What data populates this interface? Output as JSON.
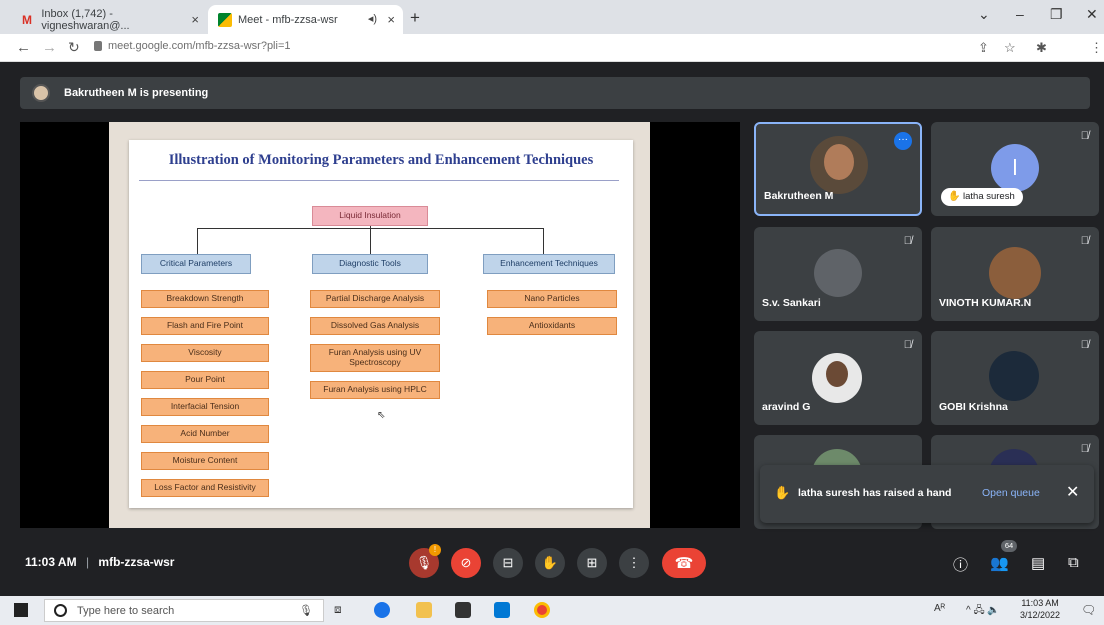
{
  "browser": {
    "tabs": [
      {
        "label": "Inbox (1,742) - vigneshwaran@...",
        "close": "×"
      },
      {
        "label": "Meet - mfb-zzsa-wsr",
        "close": "×"
      }
    ],
    "new_tab": "+",
    "url": "meet.google.com/mfb-zzsa-wsr?pli=1"
  },
  "meet": {
    "presenting_text": "Bakrutheen M is presenting",
    "slide": {
      "title": "Illustration of Monitoring Parameters and Enhancement Techniques",
      "root": "Liquid Insulation",
      "categories": [
        "Critical Parameters",
        "Diagnostic Tools",
        "Enhancement Techniques"
      ],
      "critical_parameters": [
        "Breakdown Strength",
        "Flash and Fire Point",
        "Viscosity",
        "Pour Point",
        "Interfacial Tension",
        "Acid Number",
        "Moisture Content",
        "Loss Factor and Resistivity"
      ],
      "diagnostic_tools": [
        "Partial Discharge Analysis",
        "Dissolved Gas Analysis",
        "Furan Analysis using UV Spectroscopy",
        "Furan Analysis using HPLC"
      ],
      "enhancement_techniques": [
        "Nano Particles",
        "Antioxidants"
      ]
    },
    "participants": [
      {
        "name": "Bakrutheen M"
      },
      {
        "name": "latha suresh",
        "initial": "l"
      },
      {
        "name": "S.v. Sankari"
      },
      {
        "name": "VINOTH KUMAR.N"
      },
      {
        "name": "aravind G"
      },
      {
        "name": "GOBI Krishna"
      }
    ],
    "toast": {
      "message": "latha suresh has raised a hand",
      "action": "Open queue"
    },
    "clock": "11:03 AM",
    "meeting_code": "mfb-zzsa-wsr",
    "people_count": "64",
    "accent": "#1a73e8",
    "danger": "#ea4335"
  },
  "taskbar": {
    "search_placeholder": "Type here to search",
    "time": "11:03 AM",
    "date": "3/12/2022"
  }
}
